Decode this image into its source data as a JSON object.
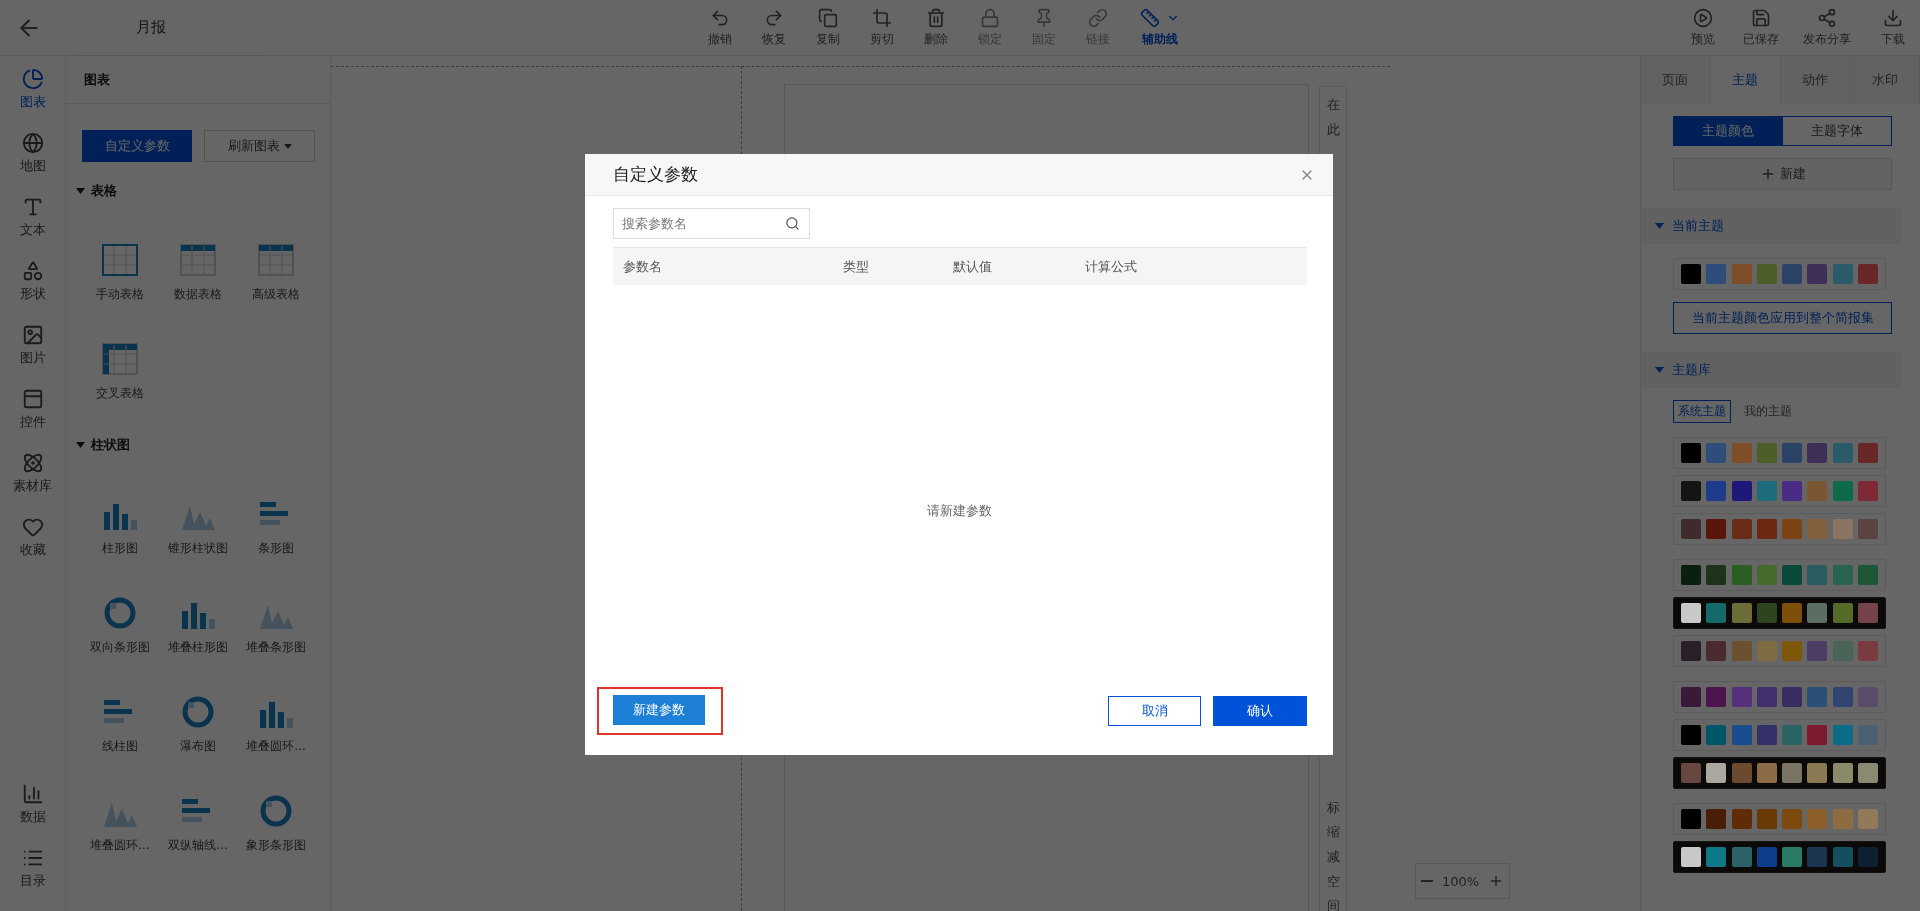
{
  "header": {
    "title": "月报"
  },
  "toolbar": [
    {
      "label": "撤销",
      "kind": "undo",
      "disabled": false,
      "selected": false
    },
    {
      "label": "恢复",
      "kind": "redo",
      "disabled": false,
      "selected": false
    },
    {
      "label": "复制",
      "kind": "copy",
      "disabled": false,
      "selected": false
    },
    {
      "label": "剪切",
      "kind": "crop",
      "disabled": false,
      "selected": false
    },
    {
      "label": "删除",
      "kind": "delete",
      "disabled": false,
      "selected": false
    },
    {
      "label": "锁定",
      "kind": "lock",
      "disabled": true,
      "selected": false
    },
    {
      "label": "固定",
      "kind": "pin",
      "disabled": true,
      "selected": false
    },
    {
      "label": "链接",
      "kind": "link",
      "disabled": true,
      "selected": false
    },
    {
      "label": "辅助线",
      "kind": "ruler",
      "disabled": false,
      "selected": true
    }
  ],
  "actions": [
    {
      "label": "预览",
      "kind": "play"
    },
    {
      "label": "已保存",
      "kind": "save"
    },
    {
      "label": "发布分享",
      "kind": "share"
    },
    {
      "label": "下载",
      "kind": "download"
    }
  ],
  "rail": [
    {
      "label": "图表",
      "kind": "chart",
      "selected": true
    },
    {
      "label": "地图",
      "kind": "map",
      "selected": false
    },
    {
      "label": "文本",
      "kind": "text",
      "selected": false
    },
    {
      "label": "形状",
      "kind": "shape",
      "selected": false
    },
    {
      "label": "图片",
      "kind": "image",
      "selected": false
    },
    {
      "label": "控件",
      "kind": "widget",
      "selected": false
    },
    {
      "label": "素材库",
      "kind": "atom",
      "selected": false
    },
    {
      "label": "收藏",
      "kind": "heart",
      "selected": false
    }
  ],
  "rail_bottom": [
    {
      "label": "数据",
      "kind": "data"
    },
    {
      "label": "目录",
      "kind": "list"
    }
  ],
  "panel": {
    "title": "图表",
    "primary_button": "自定义参数",
    "refresh_button": "刷新图表",
    "sections": [
      {
        "title": "表格",
        "expanded": true,
        "items": [
          "手动表格",
          "数据表格",
          "高级表格",
          "交叉表格"
        ]
      },
      {
        "title": "柱状图",
        "expanded": true,
        "items": [
          "柱形图",
          "锥形柱状图",
          "条形图",
          "双向条形图",
          "堆叠柱形图",
          "堆叠条形图",
          "线柱图",
          "瀑布图",
          "堆叠圆环...",
          "堆叠圆环...",
          "双纵轴线...",
          "象形条形图"
        ]
      }
    ]
  },
  "canvas": {
    "side_text_top": "在此",
    "side_text_bottom": "标缩减空间",
    "zoom": "100%"
  },
  "dialog": {
    "title": "自定义参数",
    "search": {
      "placeholder": "搜索参数名"
    },
    "columns": [
      "参数名",
      "类型",
      "默认值",
      "计算公式"
    ],
    "empty_text": "请新建参数",
    "new_button": "新建参数",
    "cancel_button": "取消",
    "confirm_button": "确认"
  },
  "right_panel": {
    "tabs": [
      {
        "label": "页面",
        "selected": false
      },
      {
        "label": "主题",
        "selected": true
      },
      {
        "label": "动作",
        "selected": false
      },
      {
        "label": "水印",
        "selected": false
      }
    ],
    "segments": [
      {
        "label": "主题颜色",
        "selected": true
      },
      {
        "label": "主题字体",
        "selected": false
      }
    ],
    "new_button": "新建",
    "current_section": {
      "title": "当前主题",
      "expanded": true
    },
    "current_palette": [
      {
        "color": "#000000"
      },
      {
        "color": "#2e4d7a"
      },
      {
        "color": "#7d4e28"
      },
      {
        "color": "#4e5e2b"
      },
      {
        "color": "#2b4366"
      },
      {
        "color": "#3e2f58"
      },
      {
        "color": "#2b5a69"
      },
      {
        "color": "#6a2727"
      }
    ],
    "apply_button": "当前主题颜色应用到整个简报集",
    "library_section": {
      "title": "主题库",
      "expanded": true
    },
    "library_tabs": [
      {
        "label": "系统主题",
        "selected": true
      },
      {
        "label": "我的主题",
        "selected": false
      }
    ],
    "palettes": [
      {
        "dark": false,
        "swatches": [
          {
            "color": "#000000"
          },
          {
            "color": "#2e4d7a"
          },
          {
            "color": "#7d4e28"
          },
          {
            "color": "#4e5e2b"
          },
          {
            "color": "#2b4366"
          },
          {
            "color": "#3e2f58"
          },
          {
            "color": "#2b5a69"
          },
          {
            "color": "#6a2727"
          }
        ]
      },
      {
        "dark": false,
        "swatches": [
          {
            "color": "#141414"
          },
          {
            "color": "#1e3c8a"
          },
          {
            "color": "#1e1878"
          },
          {
            "color": "#1f6c7c"
          },
          {
            "color": "#4a2c84"
          },
          {
            "color": "#7a5632"
          },
          {
            "color": "#0e6a48"
          },
          {
            "color": "#7e2a36"
          }
        ]
      },
      {
        "dark": false,
        "swatches": [
          {
            "color": "#3e2c2c"
          },
          {
            "color": "#5a1608"
          },
          {
            "color": "#6a2c18"
          },
          {
            "color": "#6e2812"
          },
          {
            "color": "#7a4414"
          },
          {
            "color": "#82603c"
          },
          {
            "color": "#8a7464"
          },
          {
            "color": "#5a4440"
          }
        ]
      },
      {
        "dark": false,
        "swatches": [
          {
            "color": "#0a200c"
          },
          {
            "color": "#1c3418"
          },
          {
            "color": "#2a5e22"
          },
          {
            "color": "#466a2c"
          },
          {
            "color": "#0a4a38"
          },
          {
            "color": "#2a5c60"
          },
          {
            "color": "#2a6450"
          },
          {
            "color": "#1e5636"
          }
        ]
      },
      {
        "dark": true,
        "swatches": [
          {
            "color": "#c8c8c8"
          },
          {
            "color": "#146a68"
          },
          {
            "color": "#6c6c38"
          },
          {
            "color": "#2c4420"
          },
          {
            "color": "#7c5008"
          },
          {
            "color": "#5a6e64"
          },
          {
            "color": "#566a28"
          },
          {
            "color": "#74444a"
          }
        ]
      },
      {
        "dark": false,
        "swatches": [
          {
            "color": "#2a2028"
          },
          {
            "color": "#4a2c30"
          },
          {
            "color": "#6c5030"
          },
          {
            "color": "#7e6c44"
          },
          {
            "color": "#7c5808"
          },
          {
            "color": "#4c3e66"
          },
          {
            "color": "#4a6458"
          },
          {
            "color": "#7a3c40"
          }
        ]
      },
      {
        "dark": false,
        "swatches": [
          {
            "color": "#3a1a38"
          },
          {
            "color": "#4e1450"
          },
          {
            "color": "#56307a"
          },
          {
            "color": "#42306e"
          },
          {
            "color": "#382e64"
          },
          {
            "color": "#2a5078"
          },
          {
            "color": "#344472"
          },
          {
            "color": "#5c4c6c"
          }
        ]
      },
      {
        "dark": false,
        "swatches": [
          {
            "color": "#000000"
          },
          {
            "color": "#005668"
          },
          {
            "color": "#1a4c8e"
          },
          {
            "color": "#34306a"
          },
          {
            "color": "#2a6466"
          },
          {
            "color": "#7e1a30"
          },
          {
            "color": "#0a6c88"
          },
          {
            "color": "#4c6074"
          }
        ]
      },
      {
        "dark": true,
        "swatches": [
          {
            "color": "#664840"
          },
          {
            "color": "#aaa89e"
          },
          {
            "color": "#6c4a30"
          },
          {
            "color": "#8c6c48"
          },
          {
            "color": "#7a7464"
          },
          {
            "color": "#8a7a54"
          },
          {
            "color": "#8a8a68"
          },
          {
            "color": "#8a8a70"
          }
        ]
      },
      {
        "dark": false,
        "swatches": [
          {
            "color": "#000000"
          },
          {
            "color": "#4a1e06"
          },
          {
            "color": "#602c06"
          },
          {
            "color": "#6a3a06"
          },
          {
            "color": "#7c4a0e"
          },
          {
            "color": "#8c6028"
          },
          {
            "color": "#8c6c40"
          },
          {
            "color": "#927a58"
          }
        ]
      },
      {
        "dark": true,
        "swatches": [
          {
            "color": "#c8c8c8"
          },
          {
            "color": "#0e7a88"
          },
          {
            "color": "#2a6268"
          },
          {
            "color": "#0e3e8a"
          },
          {
            "color": "#2a7a66"
          },
          {
            "color": "#1c3450"
          },
          {
            "color": "#144e60"
          },
          {
            "color": "#0e2034"
          }
        ]
      }
    ]
  }
}
